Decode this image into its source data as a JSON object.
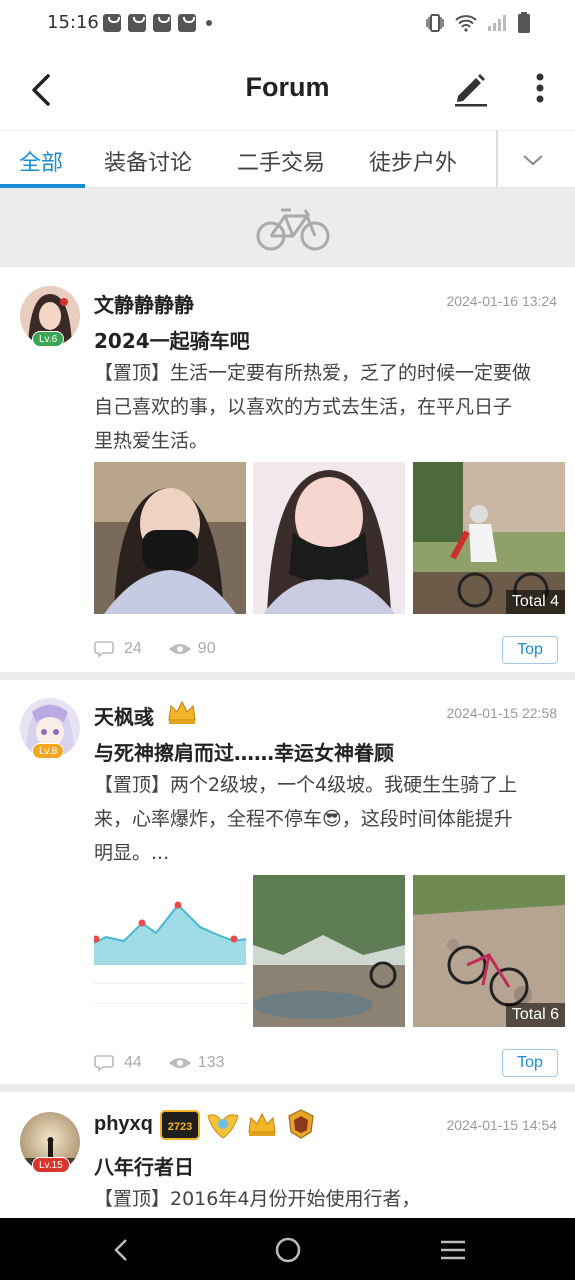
{
  "status_bar": {
    "time": "15:16"
  },
  "header": {
    "title": "Forum"
  },
  "tabs": [
    {
      "label": "全部",
      "active": true
    },
    {
      "label": "装备讨论",
      "active": false
    },
    {
      "label": "二手交易",
      "active": false
    },
    {
      "label": "徒步户外",
      "active": false
    }
  ],
  "posts": [
    {
      "author": "文静静静静",
      "level": "Lv.6",
      "date": "2024-01-16 13:24",
      "title": "2024一起骑车吧",
      "body_lines": [
        "【置顶】生活一定要有所热爱，乏了的时候一定要做",
        "自己喜欢的事，以喜欢的方式去生活，在平凡日子",
        "里热爱生活。"
      ],
      "image_total": "Total 4",
      "comments": "24",
      "views": "90",
      "top_label": "Top"
    },
    {
      "author": "天枫彧",
      "level": "Lv.8",
      "date": "2024-01-15 22:58",
      "title": "与死神擦肩而过……幸运女神眷顾",
      "body_lines": [
        "【置顶】两个2级坡，一个4级坡。我硬生生骑了上",
        "来，心率爆炸，全程不停车😎，这段时间体能提升",
        "明显。..."
      ],
      "image_total": "Total 6",
      "comments": "44",
      "views": "133",
      "top_label": "Top"
    },
    {
      "author": "phyxq",
      "level": "Lv.15",
      "pro_badge": "2723",
      "date": "2024-01-15 14:54",
      "title": "八年行者日",
      "body_lines": [
        "【置顶】2016年4月份开始使用行者，"
      ]
    }
  ],
  "colors": {
    "accent": "#1a8fd8",
    "level_green": "#3aa655",
    "level_orange": "#f5a623",
    "level_red": "#d9362b"
  }
}
